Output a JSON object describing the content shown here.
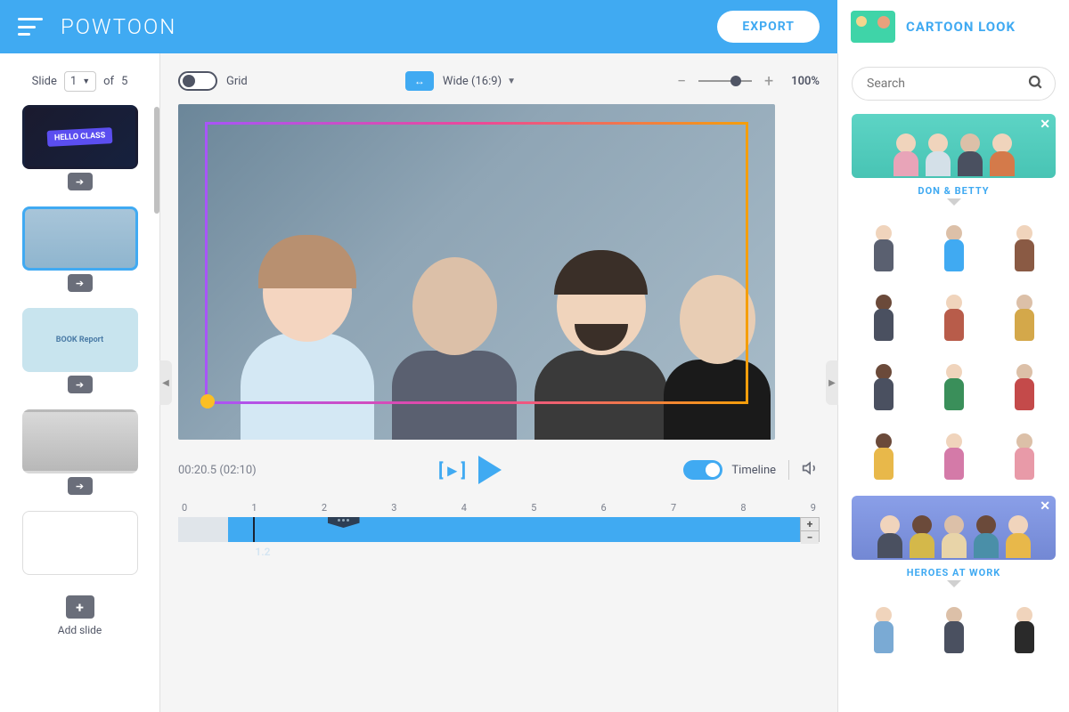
{
  "header": {
    "logo": "POWTOON",
    "export_label": "EXPORT",
    "category_title": "CARTOON LOOK"
  },
  "slides": {
    "label": "Slide",
    "current": "1",
    "of_label": "of",
    "total": "5",
    "add_label": "Add slide",
    "items": [
      {
        "name": "HELLO CLASS"
      },
      {
        "name": "characters"
      },
      {
        "name": "BOOK Report"
      },
      {
        "name": "photo"
      },
      {
        "name": "blank"
      }
    ]
  },
  "canvas": {
    "grid_label": "Grid",
    "aspect_label": "Wide (16:9)",
    "zoom": "100%"
  },
  "playback": {
    "time": "00:20.5 (02:10)",
    "timeline_label": "Timeline",
    "ruler": [
      "0",
      "1",
      "2",
      "3",
      "4",
      "5",
      "6",
      "7",
      "8",
      "9"
    ],
    "indicator": "1.2"
  },
  "assets": {
    "search_placeholder": "Search",
    "packs": [
      {
        "name": "DON & BETTY"
      },
      {
        "name": "HEROES AT WORK"
      }
    ],
    "characters_pack1": [
      {
        "head": "#f0d4bc",
        "body": "#5a6070"
      },
      {
        "head": "#dcc0a8",
        "body": "#40aaf2"
      },
      {
        "head": "#f0d4bc",
        "body": "#8a5a44"
      },
      {
        "head": "#6b4a3a",
        "body": "#4a5060"
      },
      {
        "head": "#f0d4bc",
        "body": "#b85c4a"
      },
      {
        "head": "#dcc0a8",
        "body": "#d4a84a"
      },
      {
        "head": "#6b4a3a",
        "body": "#4a5060"
      },
      {
        "head": "#f0d4bc",
        "body": "#3a8f5a"
      },
      {
        "head": "#dcc0a8",
        "body": "#c44a4a"
      },
      {
        "head": "#6b4a3a",
        "body": "#e8b84a"
      },
      {
        "head": "#f0d4bc",
        "body": "#d47aa8"
      },
      {
        "head": "#dcc0a8",
        "body": "#e89aa8"
      }
    ],
    "characters_pack2": [
      {
        "head": "#f0d4bc",
        "body": "#7aaad4"
      },
      {
        "head": "#dcc0a8",
        "body": "#4a5060"
      },
      {
        "head": "#f0d4bc",
        "body": "#2a2a2a"
      }
    ]
  }
}
